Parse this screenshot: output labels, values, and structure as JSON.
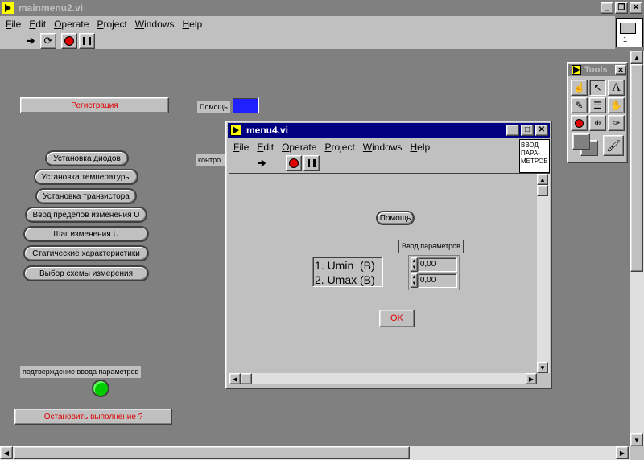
{
  "main_window": {
    "title": "mainmenu2.vi",
    "menu": [
      "File",
      "Edit",
      "Operate",
      "Project",
      "Windows",
      "Help"
    ],
    "icon_number": "1",
    "controls": {
      "registration": "Регистрация",
      "help_label": "Помощь",
      "control_label": "контро",
      "buttons": [
        "Установка диодов",
        "Установка температуры",
        "Установка транзистора",
        "Ввод пределов изменения U",
        "Шаг изменения U",
        "Статические характеристики",
        "Выбор схемы измерения"
      ],
      "confirm_label": "подтверждение ввода параметров",
      "stop_button": "Остановить выполнение ?",
      "led_color": "#00cc00"
    }
  },
  "tools_palette": {
    "title": "Tools"
  },
  "sub_window": {
    "title": "menu4.vi",
    "menu": [
      "File",
      "Edit",
      "Operate",
      "Project",
      "Windows",
      "Help"
    ],
    "icon_text": "ВВОД ПАРА- МЕТРОВ",
    "help_button": "Помощь",
    "params_label": "Ввод параметров",
    "param_names": [
      "1. Umin  (B)",
      "2. Umax (B)"
    ],
    "param_values": [
      "0,00",
      "0,00"
    ],
    "ok_button": "OK"
  },
  "colors": {
    "titlebar_active": "#000080",
    "titlebar_inactive": "#808080",
    "panel_bg": "#808080",
    "face": "#c0c0c0",
    "accent_red": "#e00000",
    "color_box": "#2020ff"
  }
}
